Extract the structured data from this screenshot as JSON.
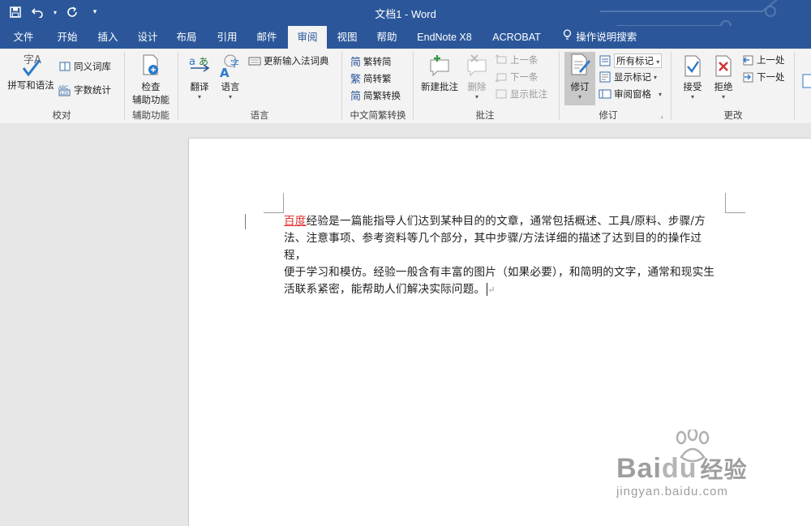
{
  "window": {
    "title": "文档1 - Word"
  },
  "tabs": [
    {
      "label": "文件"
    },
    {
      "label": "开始"
    },
    {
      "label": "插入"
    },
    {
      "label": "设计"
    },
    {
      "label": "布局"
    },
    {
      "label": "引用"
    },
    {
      "label": "邮件"
    },
    {
      "label": "审阅",
      "active": true
    },
    {
      "label": "视图"
    },
    {
      "label": "帮助"
    },
    {
      "label": "EndNote X8"
    },
    {
      "label": "ACROBAT"
    }
  ],
  "tell_me": "操作说明搜索",
  "ribbon": {
    "proofing": {
      "spelling": "拼写和语法",
      "thesaurus": "同义词库",
      "word_count": "字数统计",
      "group": "校对"
    },
    "accessibility": {
      "check_line1": "检查",
      "check_line2": "辅助功能",
      "group": "辅助功能"
    },
    "language": {
      "translate": "翻译",
      "language": "语言",
      "update_ime": "更新输入法词典",
      "group": "语言"
    },
    "chinese": {
      "to_simplified": "繁转简",
      "to_traditional": "简转繁",
      "convert": "简繁转换",
      "group": "中文简繁转换",
      "icon_simplified": "简",
      "icon_traditional": "繁",
      "icon_convert": "简"
    },
    "comments": {
      "new": "新建批注",
      "delete": "删除",
      "previous": "上一条",
      "next": "下一条",
      "show": "显示批注",
      "group": "批注"
    },
    "tracking": {
      "track": "修订",
      "all_markup": "所有标记",
      "show_markup": "显示标记",
      "review_pane": "审阅窗格",
      "group": "修订"
    },
    "changes": {
      "accept": "接受",
      "reject": "拒绝",
      "previous": "上一处",
      "next": "下一处",
      "group": "更改"
    }
  },
  "document": {
    "marked_word": "百度",
    "line1": "经验是一篇能指导人们达到某种目的的文章，通常包括概述、工具/原料、步骤/方",
    "line2": "法、注意事项、参考资料等几个部分，其中步骤/方法详细的描述了达到目的的操作过程，",
    "line3": "便于学习和模仿。经验一般含有丰富的图片（如果必要），和简明的文字，通常和现实生",
    "line4": "活联系紧密，能帮助人们解决实际问题。",
    "paragraph_mark": "↵"
  },
  "watermark": {
    "brand": "Bai",
    "brand2": "du",
    "suffix": "经验",
    "url": "jingyan.baidu.com"
  },
  "colors": {
    "titlebar": "#2b579a",
    "ribbon": "#f3f3f3",
    "tracked_insert": "#e03030"
  }
}
